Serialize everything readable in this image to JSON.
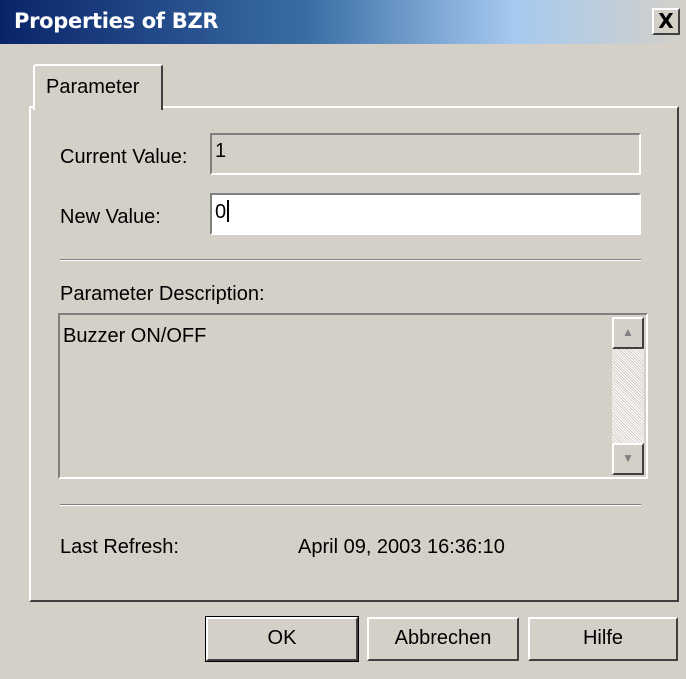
{
  "window": {
    "title": "Properties of BZR",
    "close_label": "X"
  },
  "tabs": [
    {
      "label": "Parameter",
      "active": true
    }
  ],
  "form": {
    "current_value_label": "Current Value:",
    "current_value": "1",
    "new_value_label": "New Value:",
    "new_value": "0",
    "description_label": "Parameter Description:",
    "description": "Buzzer ON/OFF",
    "last_refresh_label": "Last Refresh:",
    "last_refresh_value": "April 09, 2003 16:36:10"
  },
  "icons": {
    "scroll_up": "scroll-up-arrow-icon",
    "scroll_down": "scroll-down-arrow-icon",
    "scroll_up_glyph": "▲",
    "scroll_down_glyph": "▼"
  },
  "buttons": {
    "ok": "OK",
    "cancel": "Abbrechen",
    "help": "Hilfe"
  },
  "colors": {
    "titlebar_start": "#0a246a",
    "titlebar_end": "#d4d0c8",
    "face": "#d4d0c8"
  }
}
